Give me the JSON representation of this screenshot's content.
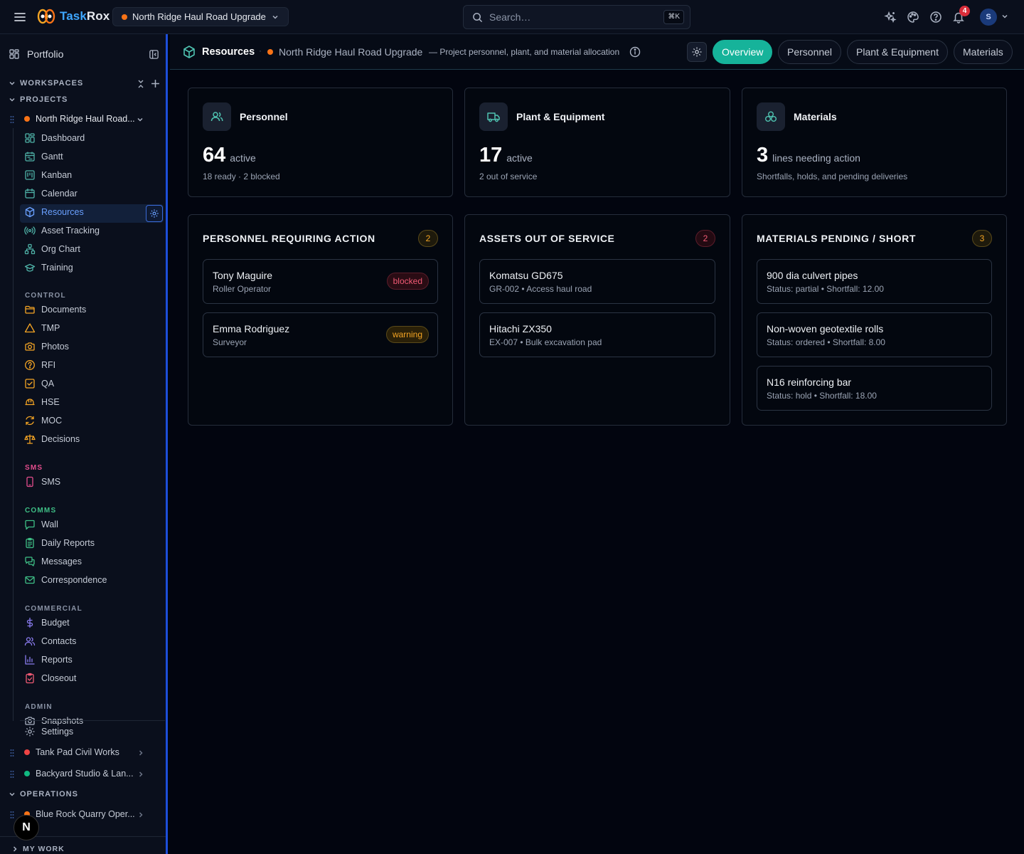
{
  "app": {
    "brand_prefix": "Task",
    "brand_suffix": "Rox"
  },
  "topbar": {
    "project_selector": "North Ridge Haul Road Upgrade",
    "search_placeholder": "Search…",
    "search_shortcut": "⌘K",
    "notification_count": "4",
    "avatar_initial": "S"
  },
  "sidebar": {
    "portfolio": "Portfolio",
    "workspaces": "WORKSPACES",
    "projects": "PROJECTS",
    "current_project": "North Ridge Haul Road...",
    "nav": [
      "Dashboard",
      "Gantt",
      "Kanban",
      "Calendar",
      "Resources",
      "Asset Tracking",
      "Org Chart",
      "Training"
    ],
    "control_label": "CONTROL",
    "control": [
      "Documents",
      "TMP",
      "Photos",
      "RFI",
      "QA",
      "HSE",
      "MOC",
      "Decisions"
    ],
    "sms_label": "SMS",
    "sms": [
      "SMS"
    ],
    "comms_label": "COMMS",
    "comms": [
      "Wall",
      "Daily Reports",
      "Messages",
      "Correspondence"
    ],
    "commercial_label": "COMMERCIAL",
    "commercial": [
      "Budget",
      "Contacts",
      "Reports",
      "Closeout"
    ],
    "admin_label": "ADMIN",
    "admin": [
      "Snapshots"
    ],
    "settings": "Settings",
    "other_projects": [
      "Tank Pad Civil Works",
      "Backyard Studio & Lan..."
    ],
    "operations": "OPERATIONS",
    "operations_items": [
      "Blue Rock Quarry Oper..."
    ],
    "my_work": "MY WORK",
    "fab": "N"
  },
  "header": {
    "section": "Resources",
    "project": "North Ridge Haul Road Upgrade",
    "description": "— Project personnel, plant, and material allocation",
    "tabs": [
      "Overview",
      "Personnel",
      "Plant & Equipment",
      "Materials"
    ]
  },
  "summary": [
    {
      "title": "Personnel",
      "value": "64",
      "unit": "active",
      "detail": "18 ready · 2 blocked"
    },
    {
      "title": "Plant & Equipment",
      "value": "17",
      "unit": "active",
      "detail": "2 out of service"
    },
    {
      "title": "Materials",
      "value": "3",
      "unit": "lines needing action",
      "detail": "Shortfalls, holds, and pending deliveries"
    }
  ],
  "panels": {
    "personnel": {
      "title": "PERSONNEL REQUIRING ACTION",
      "count": "2",
      "items": [
        {
          "name": "Tony Maguire",
          "role": "Roller Operator",
          "status": "blocked"
        },
        {
          "name": "Emma Rodriguez",
          "role": "Surveyor",
          "status": "warning"
        }
      ]
    },
    "assets": {
      "title": "ASSETS OUT OF SERVICE",
      "count": "2",
      "items": [
        {
          "name": "Komatsu GD675",
          "detail": "GR-002 • Access haul road"
        },
        {
          "name": "Hitachi ZX350",
          "detail": "EX-007 • Bulk excavation pad"
        }
      ]
    },
    "materials": {
      "title": "MATERIALS PENDING / SHORT",
      "count": "3",
      "items": [
        {
          "name": "900 dia culvert pipes",
          "detail": "Status: partial • Shortfall: 12.00"
        },
        {
          "name": "Non-woven geotextile rolls",
          "detail": "Status: ordered • Shortfall: 8.00"
        },
        {
          "name": "N16 reinforcing bar",
          "detail": "Status: hold • Shortfall: 18.00"
        }
      ]
    }
  },
  "colors": {
    "accent": "#16b39a",
    "brand": "#3ea6ff",
    "project_dot": "#f97316",
    "blocked": "#f43f5e",
    "warning": "#f5a524"
  }
}
